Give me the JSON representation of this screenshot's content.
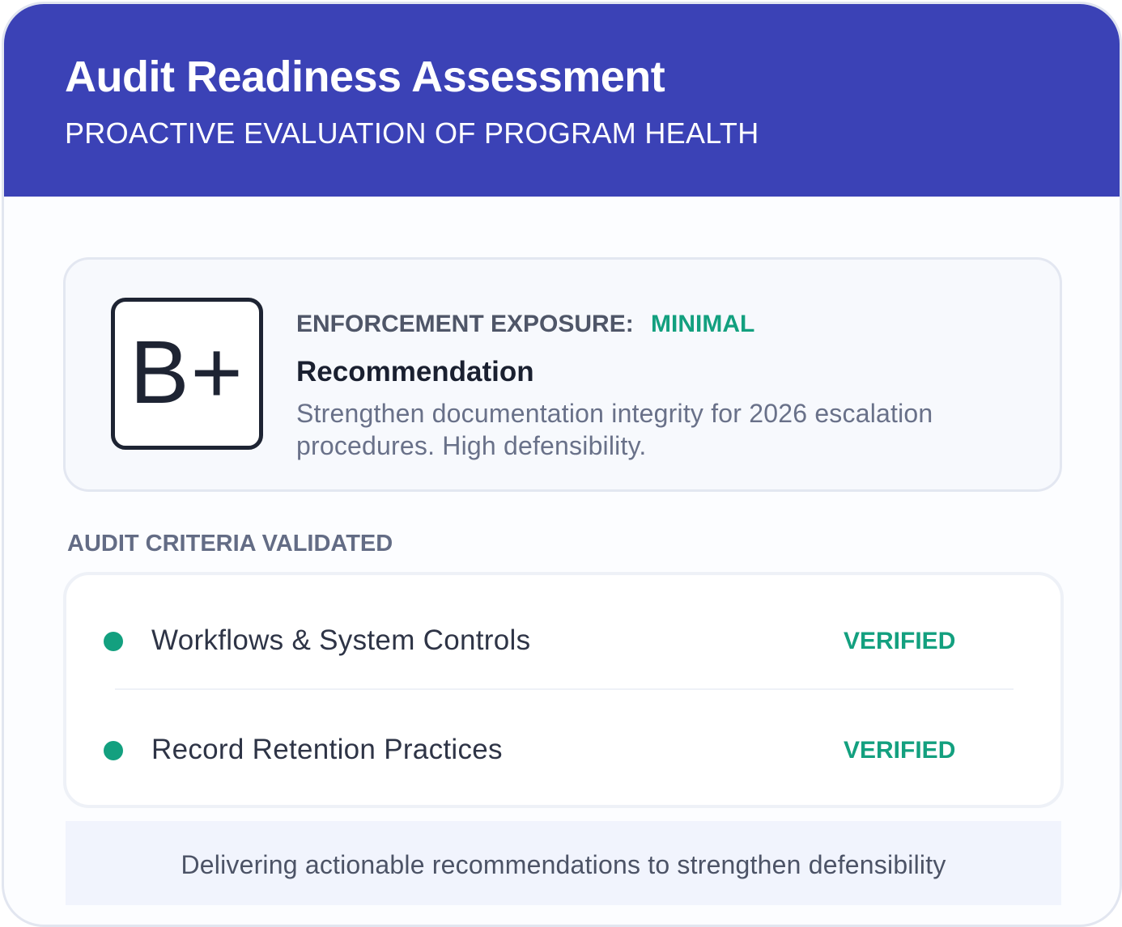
{
  "header": {
    "title": "Audit Readiness Assessment",
    "subtitle": "PROACTIVE EVALUATION OF PROGRAM HEALTH"
  },
  "summary": {
    "grade": "B+",
    "exposure_label": "ENFORCEMENT EXPOSURE:",
    "exposure_value": "MINIMAL",
    "recommendation_heading": "Recommendation",
    "recommendation_body": "Strengthen documentation integrity for 2026 escalation procedures. High defensibility."
  },
  "criteria": {
    "title": "AUDIT CRITERIA VALIDATED",
    "items": [
      {
        "label": "Workflows & System Controls",
        "status": "VERIFIED"
      },
      {
        "label": "Record Retention Practices",
        "status": "VERIFIED"
      }
    ]
  },
  "footer": {
    "text": "Delivering actionable recommendations to strengthen defensibility"
  },
  "colors": {
    "header_background": "#3b42b6",
    "status_accent": "#13a07f",
    "footer_background": "#f1f4fd"
  }
}
